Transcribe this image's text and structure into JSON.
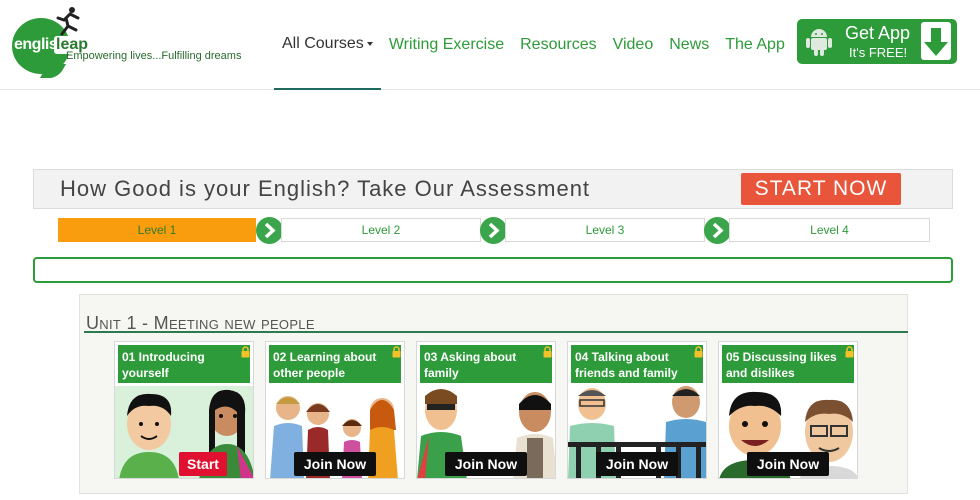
{
  "brand": {
    "word1": "english",
    "word2": "leap",
    "tagline": "Empowering lives...Fulfilling dreams"
  },
  "nav": [
    {
      "label": "All Courses",
      "active": true
    },
    {
      "label": "Writing Exercise"
    },
    {
      "label": "Resources"
    },
    {
      "label": "Video"
    },
    {
      "label": "News"
    },
    {
      "label": "The App"
    }
  ],
  "get_app": {
    "title": "Get App",
    "subtitle": "It's FREE!"
  },
  "assessment": {
    "text": "How Good is your English? Take Our Assessment",
    "cta": "START NOW"
  },
  "levels": [
    "Level 1",
    "Level 2",
    "Level 3",
    "Level 4"
  ],
  "active_level": 0,
  "unit": {
    "title": "Unit 1 - Meeting new people",
    "lessons": [
      {
        "title": "01 Introducing yourself",
        "button": "Start"
      },
      {
        "title": "02 Learning about other people",
        "button": "Join Now"
      },
      {
        "title": "03 Asking about family",
        "button": "Join Now"
      },
      {
        "title": "04 Talking about friends and family",
        "button": "Join Now"
      },
      {
        "title": "05 Discussing likes and dislikes",
        "button": "Join Now"
      }
    ]
  },
  "colors": {
    "brand_green": "#2e9b3a",
    "level_active": "#f99c0d",
    "start_now": "#e8553b",
    "start_btn": "#e01030"
  }
}
